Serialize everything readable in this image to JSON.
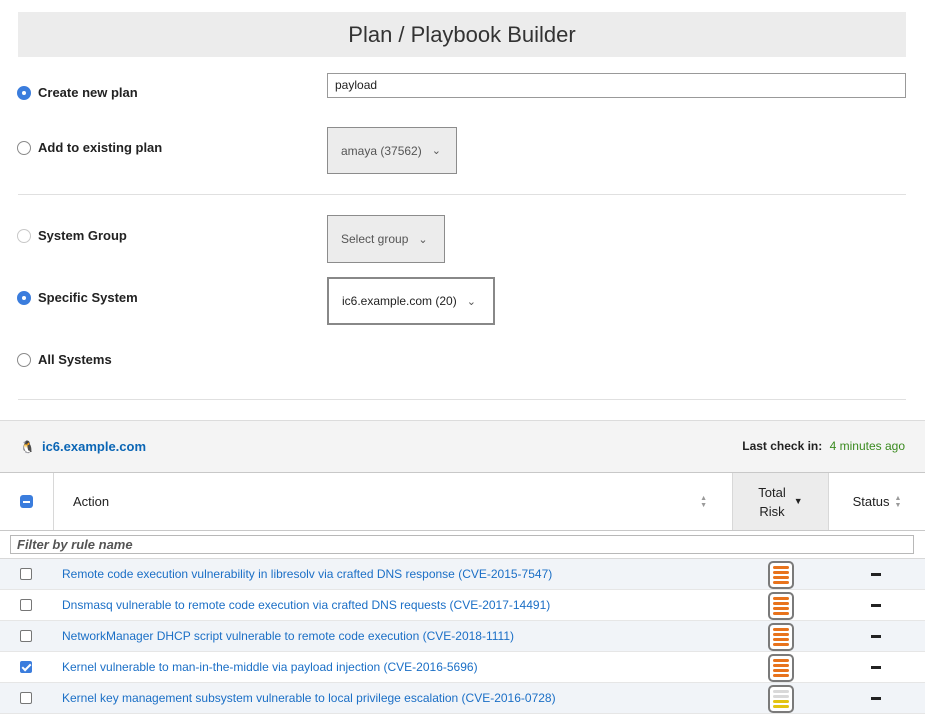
{
  "header": {
    "title": "Plan / Playbook Builder"
  },
  "plan_options": {
    "create_new": {
      "label": "Create new plan",
      "checked": true
    },
    "add_existing": {
      "label": "Add to existing plan",
      "checked": false
    },
    "plan_name_value": "payload",
    "existing_plan_select": "amaya (37562)"
  },
  "target_options": {
    "system_group": {
      "label": "System Group",
      "checked": false
    },
    "group_select": "Select group",
    "specific_system": {
      "label": "Specific System",
      "checked": true
    },
    "system_select": "ic6.example.com (20)",
    "all_systems": {
      "label": "All Systems",
      "checked": false
    }
  },
  "system": {
    "name": "ic6.example.com",
    "os_icon": "linux-tux-icon",
    "last_checkin_label": "Last check in:",
    "last_checkin_value": "4 minutes ago"
  },
  "table": {
    "columns": {
      "action": "Action",
      "risk_line1": "Total",
      "risk_line2": "Risk",
      "status": "Status"
    },
    "filter_placeholder": "Filter by rule name",
    "rows": [
      {
        "rule": "Remote code execution vulnerability in libresolv via crafted DNS response (CVE-2015-7547)",
        "checked": false,
        "risk": "high",
        "status": "—"
      },
      {
        "rule": "Dnsmasq vulnerable to remote code execution via crafted DNS requests (CVE-2017-14491)",
        "checked": false,
        "risk": "high",
        "status": "—"
      },
      {
        "rule": "NetworkManager DHCP script vulnerable to remote code execution (CVE-2018-1111)",
        "checked": false,
        "risk": "high",
        "status": "—"
      },
      {
        "rule": "Kernel vulnerable to man-in-the-middle via payload injection (CVE-2016-5696)",
        "checked": true,
        "risk": "high",
        "status": "—"
      },
      {
        "rule": "Kernel key management subsystem vulnerable to local privilege escalation (CVE-2016-0728)",
        "checked": false,
        "risk": "medium",
        "status": "—"
      }
    ]
  },
  "colors": {
    "accent": "#3b7ddd",
    "link": "#1b6fc6",
    "risk_high": "#e8731c",
    "risk_medium": "#e3c413",
    "checkin": "#3a8a1f"
  }
}
